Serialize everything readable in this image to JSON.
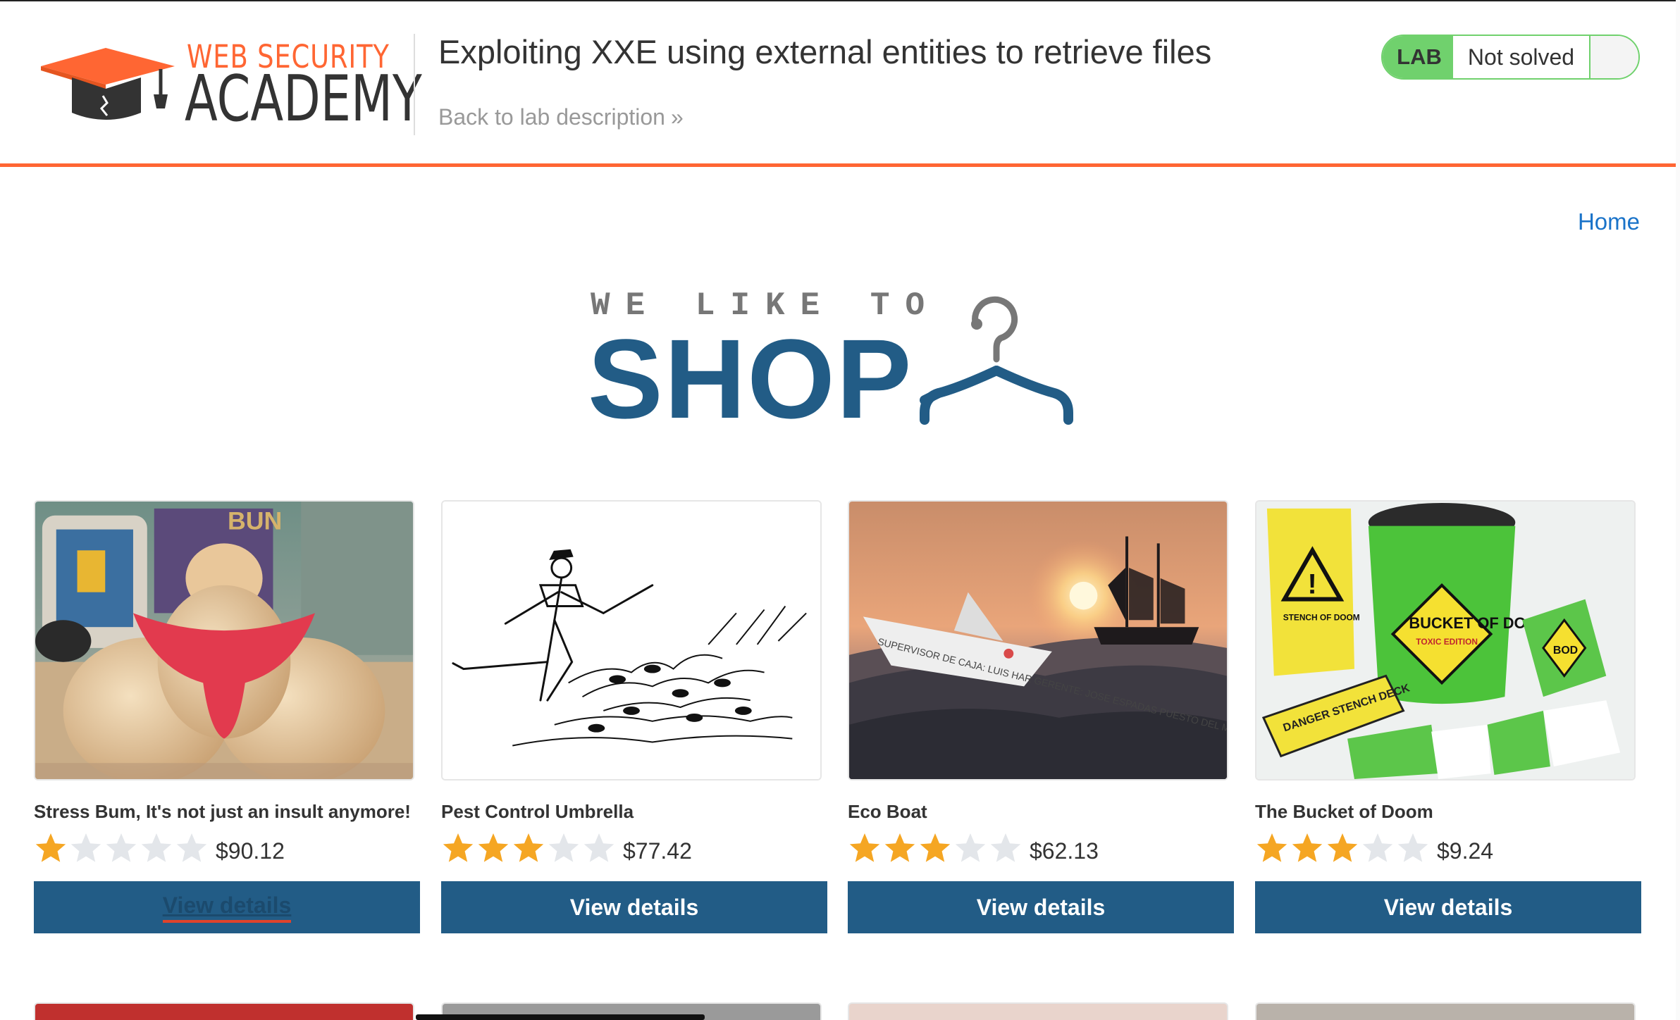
{
  "header": {
    "logo_top": "WEB SECURITY",
    "logo_bottom": "ACADEMY",
    "lab_title": "Exploiting XXE using external entities to retrieve files",
    "back_link": "Back to lab description",
    "lab_badge": "LAB",
    "lab_status": "Not solved",
    "accent_color": "#ff6633",
    "status_color": "#70d16d"
  },
  "nav": {
    "home": "Home"
  },
  "hero": {
    "small": "WE LIKE TO",
    "big": "SHOP",
    "color": "#225c86"
  },
  "products": [
    {
      "name": "Stress Bum, It's not just an insult anymore!",
      "rating": 1,
      "rating_max": 5,
      "price": "$90.12",
      "button": "View details",
      "image_icon": "stress-bum-photo"
    },
    {
      "name": "Pest Control Umbrella",
      "rating": 3,
      "rating_max": 5,
      "price": "$77.42",
      "button": "View details",
      "image_icon": "pied-piper-sketch"
    },
    {
      "name": "Eco Boat",
      "rating": 3,
      "rating_max": 5,
      "price": "$62.13",
      "button": "View details",
      "image_icon": "paper-boat-sunset-photo"
    },
    {
      "name": "The Bucket of Doom",
      "rating": 3,
      "rating_max": 5,
      "price": "$9.24",
      "button": "View details",
      "image_icon": "bucket-of-doom-photo"
    }
  ],
  "product_images": {
    "bum_mug_label": "BUN",
    "bucket_title": "BUCKET OF DOOM",
    "bucket_sub": "TOXIC EDITION",
    "bucket_card": "BOD",
    "bucket_deck": "DANGER STENCH DECK",
    "bucket_bag": "STENCH OF DOOM",
    "boat_text": "SUPERVISOR DE CAJA: LUIS HAR GERENTE: JOSE ESPADAS PUESTO DEL MES DE MAYO"
  },
  "colors": {
    "button_bg": "#225c86",
    "star_on": "#f5a623",
    "star_off": "#e3e6ea",
    "link": "#1a73c9"
  }
}
